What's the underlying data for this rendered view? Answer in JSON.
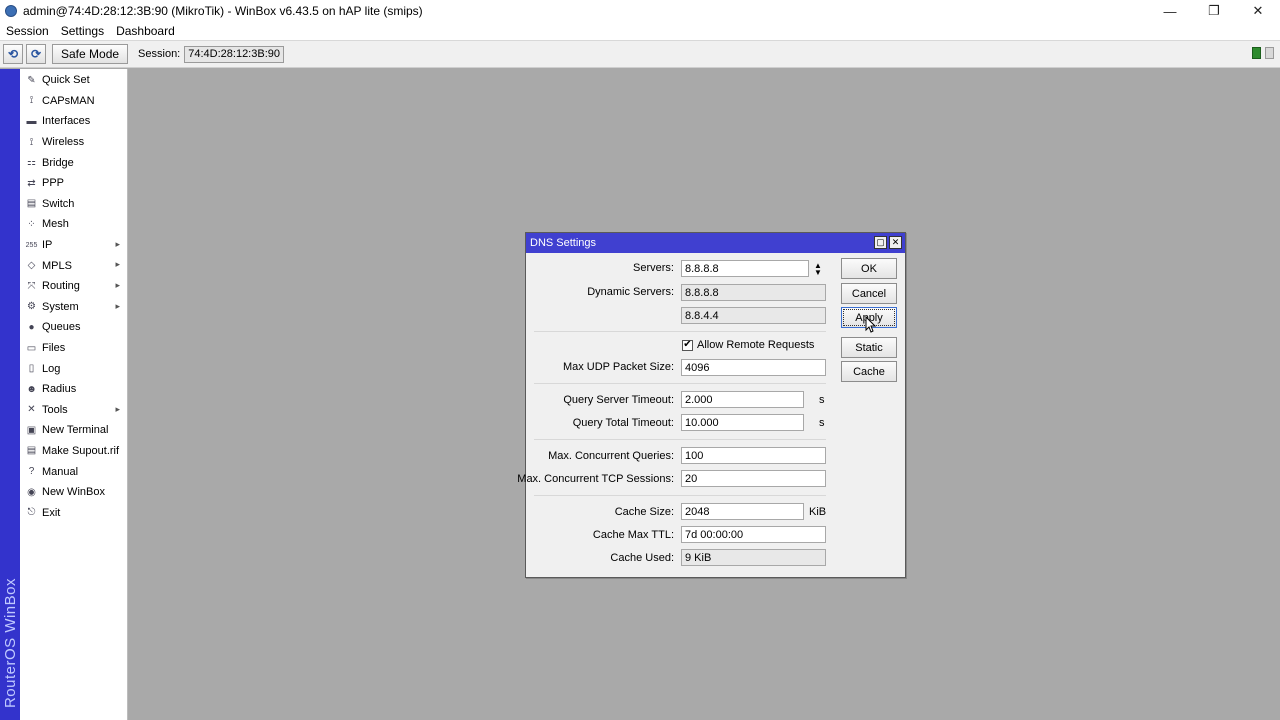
{
  "window": {
    "title": "admin@74:4D:28:12:3B:90 (MikroTik) - WinBox v6.43.5 on hAP lite (smips)",
    "minimize": "—",
    "restore": "❐",
    "close": "✕"
  },
  "menu": [
    "Session",
    "Settings",
    "Dashboard"
  ],
  "toolbar": {
    "undo": "⟲",
    "redo": "⟳",
    "safe_mode": "Safe Mode",
    "session_label": "Session:",
    "session_value": "74:4D:28:12:3B:90"
  },
  "brand": "RouterOS WinBox",
  "sidebar": {
    "items": [
      {
        "label": "Quick Set",
        "icon": "quick-set-icon",
        "glyph": "✎",
        "submenu": false
      },
      {
        "label": "CAPsMAN",
        "icon": "capsman-icon",
        "glyph": "⟟",
        "submenu": false
      },
      {
        "label": "Interfaces",
        "icon": "interfaces-icon",
        "glyph": "▬",
        "submenu": false
      },
      {
        "label": "Wireless",
        "icon": "wireless-icon",
        "glyph": "⟟",
        "submenu": false
      },
      {
        "label": "Bridge",
        "icon": "bridge-icon",
        "glyph": "⚏",
        "submenu": false
      },
      {
        "label": "PPP",
        "icon": "ppp-icon",
        "glyph": "⇄",
        "submenu": false
      },
      {
        "label": "Switch",
        "icon": "switch-icon",
        "glyph": "▤",
        "submenu": false
      },
      {
        "label": "Mesh",
        "icon": "mesh-icon",
        "glyph": "⁘",
        "submenu": false
      },
      {
        "label": "IP",
        "icon": "ip-icon",
        "glyph": "255",
        "submenu": true
      },
      {
        "label": "MPLS",
        "icon": "mpls-icon",
        "glyph": "◇",
        "submenu": true
      },
      {
        "label": "Routing",
        "icon": "routing-icon",
        "glyph": "⤧",
        "submenu": true
      },
      {
        "label": "System",
        "icon": "system-icon",
        "glyph": "⚙",
        "submenu": true
      },
      {
        "label": "Queues",
        "icon": "queues-icon",
        "glyph": "●",
        "submenu": false
      },
      {
        "label": "Files",
        "icon": "files-icon",
        "glyph": "▭",
        "submenu": false
      },
      {
        "label": "Log",
        "icon": "log-icon",
        "glyph": "▯",
        "submenu": false
      },
      {
        "label": "Radius",
        "icon": "radius-icon",
        "glyph": "☻",
        "submenu": false
      },
      {
        "label": "Tools",
        "icon": "tools-icon",
        "glyph": "✕",
        "submenu": true
      },
      {
        "label": "New Terminal",
        "icon": "terminal-icon",
        "glyph": "▣",
        "submenu": false
      },
      {
        "label": "Make Supout.rif",
        "icon": "supout-icon",
        "glyph": "▤",
        "submenu": false
      },
      {
        "label": "Manual",
        "icon": "manual-icon",
        "glyph": "?",
        "submenu": false
      },
      {
        "label": "New WinBox",
        "icon": "winbox-icon",
        "glyph": "◉",
        "submenu": false
      },
      {
        "label": "Exit",
        "icon": "exit-icon",
        "glyph": "⎋",
        "submenu": false
      }
    ]
  },
  "dialog": {
    "title": "DNS Settings",
    "servers_label": "Servers:",
    "servers_value": "8.8.8.8",
    "dynamic_servers_label": "Dynamic Servers:",
    "dynamic_server_1": "8.8.8.8",
    "dynamic_server_2": "8.8.4.4",
    "allow_remote_label": "Allow Remote Requests",
    "allow_remote_checked": true,
    "max_udp_label": "Max UDP Packet Size:",
    "max_udp_value": "4096",
    "query_server_timeout_label": "Query Server Timeout:",
    "query_server_timeout_value": "2.000",
    "query_total_timeout_label": "Query Total Timeout:",
    "query_total_timeout_value": "10.000",
    "timeout_unit": "s",
    "max_concurrent_queries_label": "Max. Concurrent Queries:",
    "max_concurrent_queries_value": "100",
    "max_concurrent_tcp_label": "Max. Concurrent TCP Sessions:",
    "max_concurrent_tcp_value": "20",
    "cache_size_label": "Cache Size:",
    "cache_size_value": "2048",
    "cache_size_unit": "KiB",
    "cache_max_ttl_label": "Cache Max TTL:",
    "cache_max_ttl_value": "7d 00:00:00",
    "cache_used_label": "Cache Used:",
    "cache_used_value": "9 KiB",
    "buttons": {
      "ok": "OK",
      "cancel": "Cancel",
      "apply": "Apply",
      "static": "Static",
      "cache": "Cache"
    }
  }
}
